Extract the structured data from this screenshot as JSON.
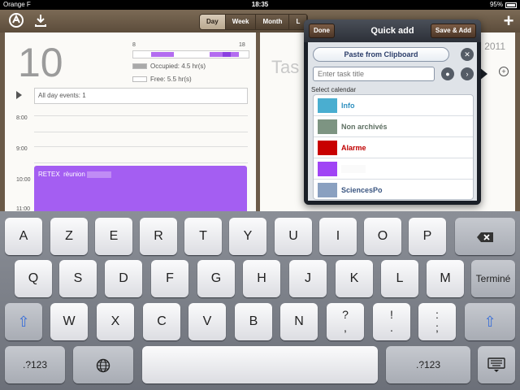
{
  "status": {
    "carrier": "Orange F",
    "time": "18:35",
    "battery": "95%"
  },
  "toolbar": {
    "view_tabs": [
      "Day",
      "Week",
      "Month",
      "L"
    ],
    "active_tab": "Day",
    "left_icons": [
      "app-logo-icon",
      "download-icon"
    ],
    "right_icon": "plus-icon"
  },
  "day": {
    "date_number": "10",
    "scale_start": "8",
    "scale_end": "18",
    "occupied_label": "Occupied: 4.5 hr(s)",
    "free_label": "Free: 5.5 hr(s)",
    "all_day": "All day events: 1",
    "hours": [
      "8:00",
      "9:00",
      "10:00",
      "11:00"
    ],
    "event_title": "RETEX",
    "event_sub": "rèunion",
    "event_color": "#a45ef2"
  },
  "right_page": {
    "title": "Tas",
    "year": "2011"
  },
  "quick_add": {
    "title": "Quick add",
    "done_label": "Done",
    "save_label": "Save & Add",
    "paste_label": "Paste from Clipboard",
    "task_placeholder": "Enter task title",
    "select_label": "Select calendar",
    "calendars": [
      {
        "name": "Info",
        "color": "#4aaed0",
        "text_color": "#2d8fbf"
      },
      {
        "name": "Non archivés",
        "color": "#7d9482",
        "text_color": "#5e6f62"
      },
      {
        "name": "Alarme",
        "color": "#c80000",
        "text_color": "#c00000"
      },
      {
        "name": "",
        "color": "#a044f5",
        "text_color": "#a044f5"
      },
      {
        "name": "SciencesPo",
        "color": "#8aa0c0",
        "text_color": "#3a5580"
      }
    ]
  },
  "keyboard": {
    "row1": [
      "A",
      "Z",
      "E",
      "R",
      "T",
      "Y",
      "U",
      "I",
      "O",
      "P"
    ],
    "row2": [
      "Q",
      "S",
      "D",
      "F",
      "G",
      "H",
      "J",
      "K",
      "L",
      "M"
    ],
    "row3": [
      "W",
      "X",
      "C",
      "V",
      "B",
      "N"
    ],
    "row3_punct": [
      [
        "?",
        ","
      ],
      [
        "!",
        "."
      ],
      [
        ":",
        ";"
      ]
    ],
    "return_label": "Terminé",
    "numbers_label": ".?123",
    "backspace_icon": "backspace-icon",
    "globe_icon": "globe-icon",
    "hide_keyboard_icon": "keyboard-hide-icon",
    "shift_icon": "shift-icon"
  }
}
